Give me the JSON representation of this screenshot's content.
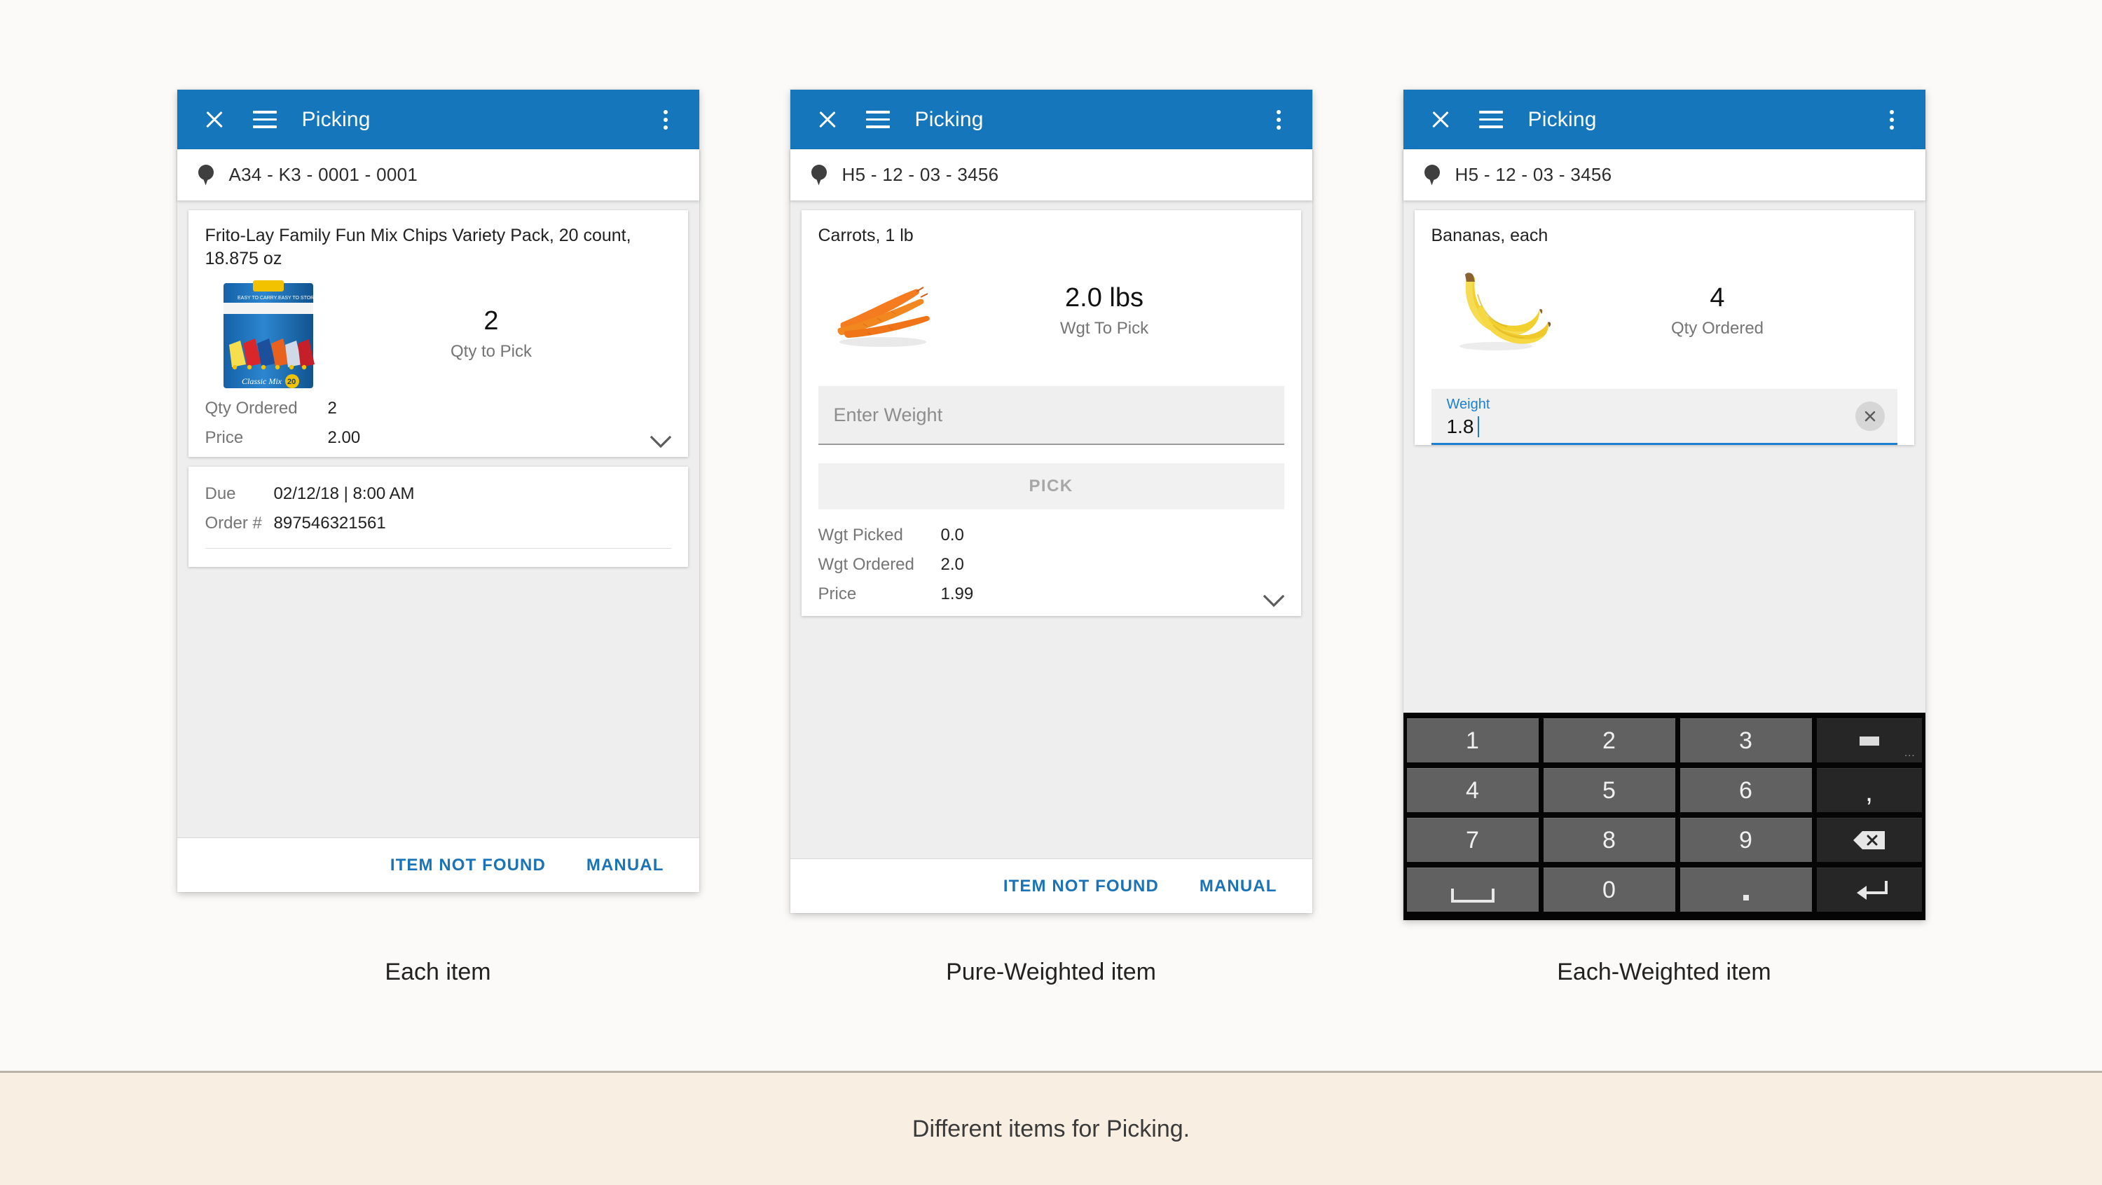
{
  "page": {
    "background_color": "#fbfaf8",
    "band_color": "#f8efe2",
    "accent_blue": "#1676bc",
    "link_blue": "#1a73b7",
    "caption_note": "Different items for Picking."
  },
  "panels": [
    {
      "id": "each-item",
      "caption": "Each item",
      "appbar": {
        "title": "Picking",
        "close_icon": "close-icon",
        "menu_icon": "hamburger-menu-icon",
        "more_icon": "overflow-menu-icon"
      },
      "location": {
        "icon": "location-pin-icon",
        "text": "A34 - K3 - 0001 - 0001"
      },
      "item": {
        "title": "Frito-Lay Family Fun Mix Chips Variety Pack, 20 count, 18.875 oz",
        "image": "chips-variety-pack-image",
        "metric_value": "2",
        "metric_label": "Qty to Pick",
        "details": [
          {
            "label": "Qty Ordered",
            "value": "2"
          },
          {
            "label": "Price",
            "value": "2.00"
          }
        ],
        "expand_icon": "chevron-down-icon"
      },
      "order": {
        "details": [
          {
            "label": "Due",
            "value": "02/12/18  |  8:00 AM"
          },
          {
            "label": "Order #",
            "value": "897546321561"
          }
        ]
      },
      "footer": {
        "item_not_found": "ITEM NOT FOUND",
        "manual": "MANUAL"
      }
    },
    {
      "id": "pure-weighted-item",
      "caption": "Pure-Weighted item",
      "appbar": {
        "title": "Picking",
        "close_icon": "close-icon",
        "menu_icon": "hamburger-menu-icon",
        "more_icon": "overflow-menu-icon"
      },
      "location": {
        "icon": "location-pin-icon",
        "text": "H5 - 12 - 03 - 3456"
      },
      "item": {
        "title": "Carrots, 1 lb",
        "image": "carrots-image",
        "metric_value": "2.0 lbs",
        "metric_label": "Wgt To Pick",
        "weight_input_placeholder": "Enter Weight",
        "pick_button": "PICK",
        "details": [
          {
            "label": "Wgt Picked",
            "value": "0.0"
          },
          {
            "label": "Wgt Ordered",
            "value": "2.0"
          },
          {
            "label": "Price",
            "value": "1.99"
          }
        ],
        "expand_icon": "chevron-down-icon"
      },
      "footer": {
        "item_not_found": "ITEM NOT FOUND",
        "manual": "MANUAL"
      }
    },
    {
      "id": "each-weighted-item",
      "caption": "Each-Weighted item",
      "appbar": {
        "title": "Picking",
        "close_icon": "close-icon",
        "menu_icon": "hamburger-menu-icon",
        "more_icon": "overflow-menu-icon"
      },
      "location": {
        "icon": "location-pin-icon",
        "text": "H5 - 12 - 03 - 3456"
      },
      "item": {
        "title": "Bananas, each",
        "image": "bananas-image",
        "metric_value": "4",
        "metric_label": "Qty Ordered",
        "weight_field_label": "Weight",
        "weight_field_value": "1.8",
        "clear_icon": "clear-x-icon"
      },
      "keyboard": {
        "rows": [
          [
            {
              "label": "1",
              "kind": "num"
            },
            {
              "label": "2",
              "kind": "num"
            },
            {
              "label": "3",
              "kind": "num"
            },
            {
              "label": "-",
              "kind": "dark-minus",
              "hint": "..."
            }
          ],
          [
            {
              "label": "4",
              "kind": "num"
            },
            {
              "label": "5",
              "kind": "num"
            },
            {
              "label": "6",
              "kind": "num"
            },
            {
              "label": ",",
              "kind": "dark"
            }
          ],
          [
            {
              "label": "7",
              "kind": "num"
            },
            {
              "label": "8",
              "kind": "num"
            },
            {
              "label": "9",
              "kind": "num"
            },
            {
              "label": "backspace",
              "kind": "dark-backspace"
            }
          ],
          [
            {
              "label": "space",
              "kind": "num-space"
            },
            {
              "label": "0",
              "kind": "num"
            },
            {
              "label": ".",
              "kind": "num-dot"
            },
            {
              "label": "enter",
              "kind": "dark-enter"
            }
          ]
        ]
      }
    }
  ]
}
